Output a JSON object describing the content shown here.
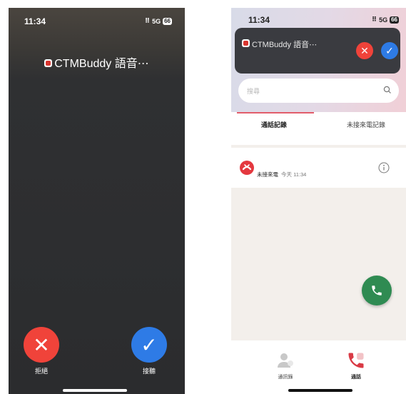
{
  "incoming": {
    "time": "11:34",
    "signal": "5G",
    "battery": "66",
    "caller": "CTMBuddy 語音⋯",
    "decline_label": "拒絕",
    "accept_label": "接聽",
    "decline_color": "#f0433a",
    "accept_color": "#2e7be6"
  },
  "call_log": {
    "time": "11:34",
    "signal": "5G",
    "battery": "66",
    "banner": {
      "title": "CTMBuddy 語音⋯"
    },
    "search": {
      "placeholder": "搜尋"
    },
    "tabs": [
      {
        "label": "通話記錄",
        "active": true
      },
      {
        "label": "未接來電記錄",
        "active": false
      }
    ],
    "entries": [
      {
        "status": "未接來電",
        "time": "今天 11:34"
      }
    ],
    "bottom_nav": [
      {
        "label": "通訊錄",
        "icon": "contacts-icon"
      },
      {
        "label": "通話",
        "icon": "phone-icon",
        "active": true
      }
    ],
    "accent_color": "#e25c6a",
    "fab_color": "#2f8b52"
  }
}
